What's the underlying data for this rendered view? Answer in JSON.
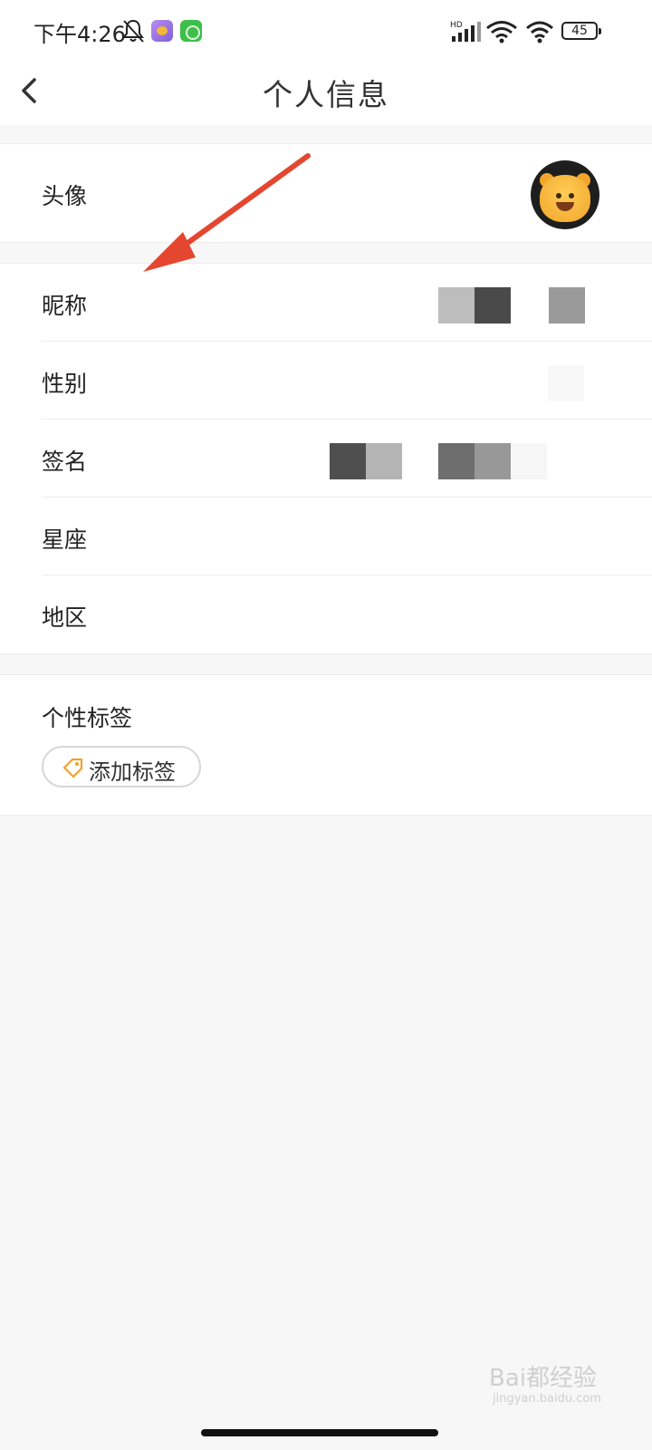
{
  "status_bar": {
    "time": "下午4:26",
    "signal_label": "HD",
    "battery": "45",
    "icons": [
      "bell-off-icon",
      "app-bear-icon",
      "app-green-icon",
      "signal-icon",
      "wifi-icon",
      "wifi-icon",
      "battery-icon"
    ]
  },
  "nav": {
    "back_icon": "chevron-left-icon",
    "title": "个人信息"
  },
  "avatar_row": {
    "label": "头像"
  },
  "fields": [
    {
      "label": "昵称",
      "value_redacted": true
    },
    {
      "label": "性别",
      "value_redacted": true
    },
    {
      "label": "签名",
      "value_redacted": true
    },
    {
      "label": "星座",
      "value_redacted": false
    },
    {
      "label": "地区",
      "value_redacted": false
    }
  ],
  "tags": {
    "title": "个性标签",
    "add_label": "添加标签",
    "add_icon": "tag-icon"
  },
  "annotation": {
    "type": "arrow",
    "color": "#e5462f"
  },
  "watermark": {
    "logo": "Bai都经验",
    "url": "jingyan.baidu.com"
  }
}
